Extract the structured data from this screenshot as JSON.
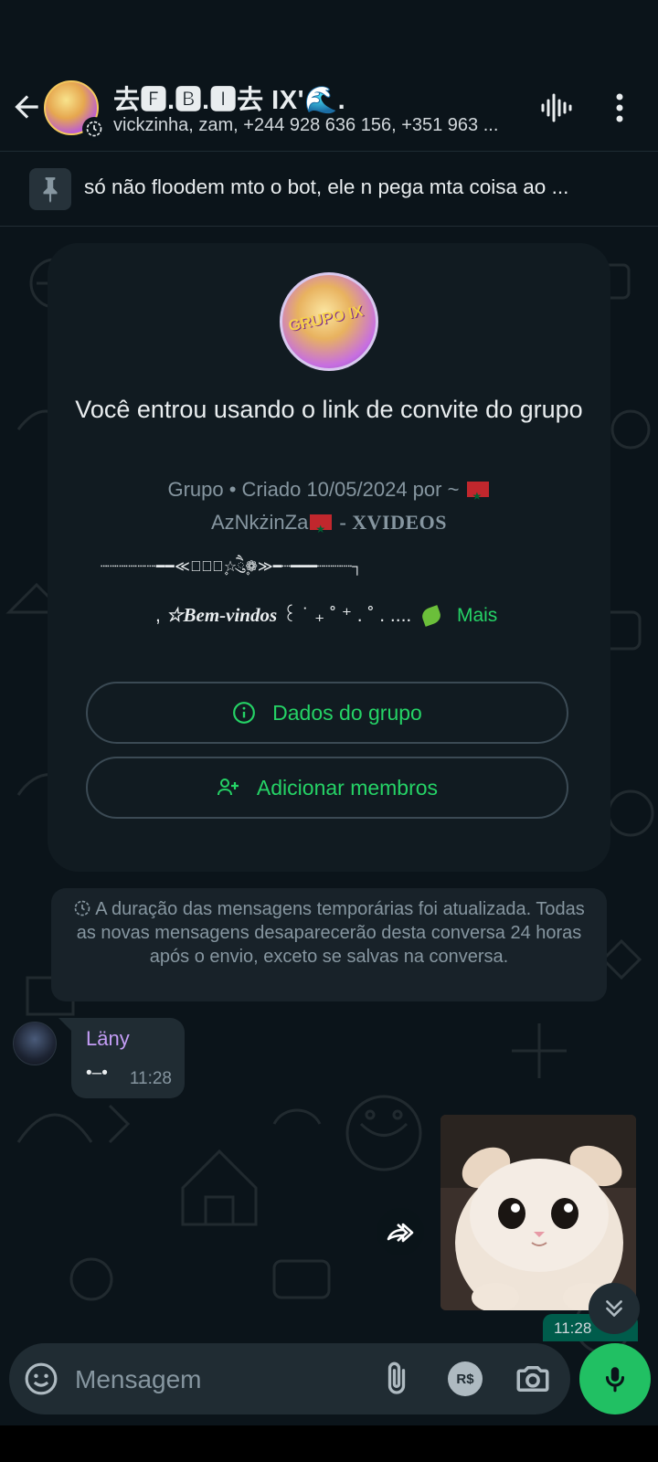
{
  "header": {
    "title": "去🅵.🅱.🅸去 IX'🌊.",
    "subtitle": "vickzinha, zam, +244 928 636 156, +351 963 ...",
    "back_icon": "arrow-left-icon",
    "voice_icon": "audio-waveform-icon",
    "menu_icon": "more-vertical-icon"
  },
  "pinned": {
    "text": "só não floodem mto o bot, ele n pega mta coisa ao ..."
  },
  "card": {
    "avatar_text": "GRUPO IX",
    "title": "Você entrou usando o link de convite do grupo",
    "meta_line1": "Grupo • Criado 10/05/2024 por ~",
    "meta_name": "AzNkżinZa",
    "meta_suffix": "- XVIDEOS",
    "deco": "┈┈┈┈┈┈━━≪❁ཻུ۪۪☆ཻུ۪۪❁≫━┈━━━┈┈┈┈┐",
    "welcome": "☆Bem-vindos",
    "welcome_tail": "꒰ ˙ ₊ ˚ ⁺ . ˚ . ....",
    "more": "Mais",
    "btn_info": "Dados do grupo",
    "btn_add": "Adicionar membros"
  },
  "system_message": "A duração das mensagens temporárias foi atualizada. Todas as novas mensagens desaparecerão desta conversa 24 horas após o envio, exceto se salvas na conversa.",
  "incoming": {
    "sender": "Läny",
    "text": "•–•",
    "time": "11:28"
  },
  "outgoing": {
    "image_desc": "kitten-sticker",
    "time": "11:28"
  },
  "composer": {
    "placeholder": "Mensagem",
    "pay_label": "R$"
  },
  "colors": {
    "accent": "#25d366",
    "background": "#0b141a",
    "bubble_in": "#202c33",
    "bubble_out": "#005c4b",
    "sender_name": "#c49df6"
  }
}
